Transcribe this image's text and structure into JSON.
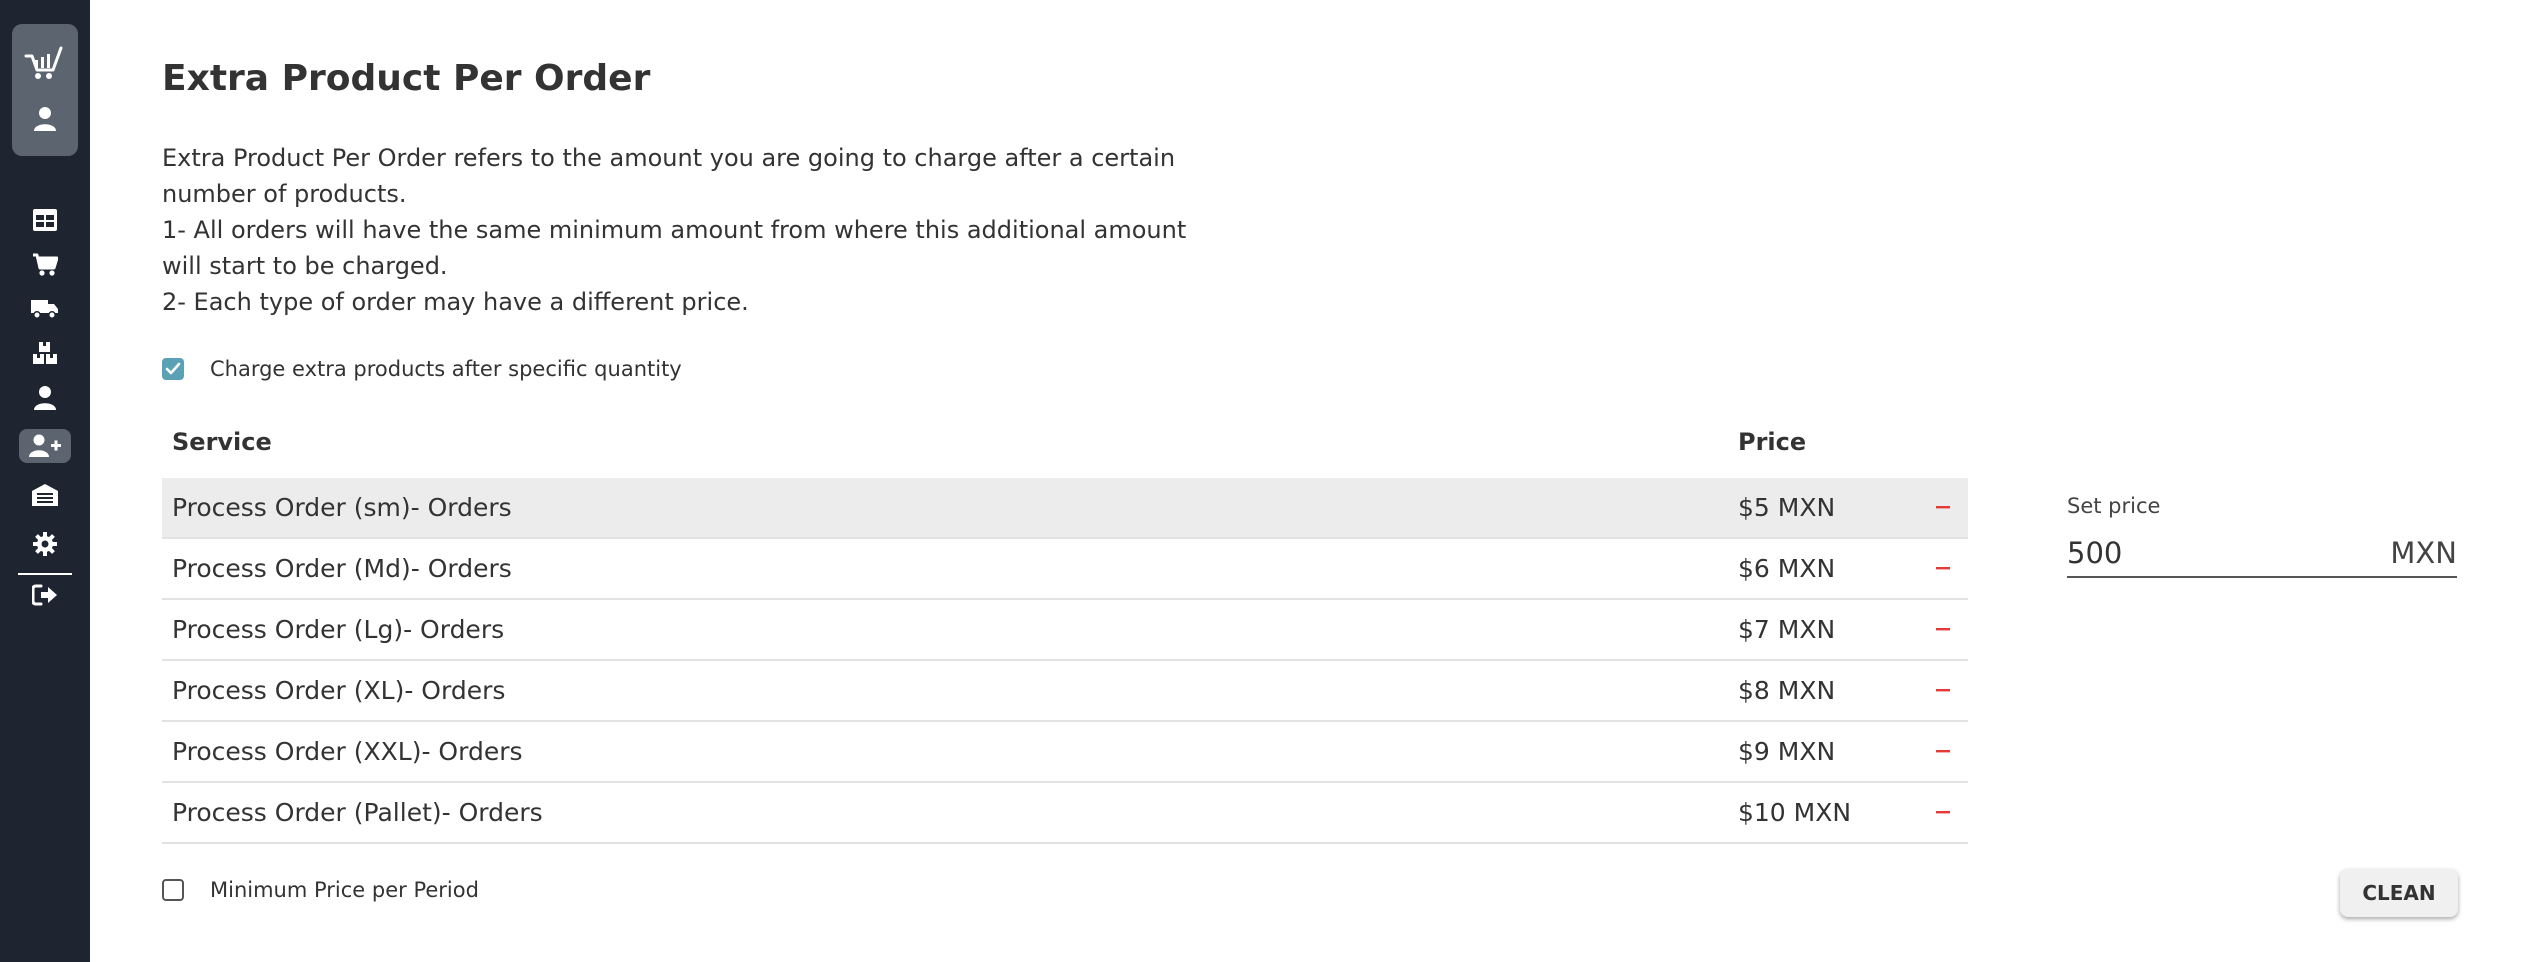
{
  "page": {
    "title": "Extra Product Per Order",
    "description": [
      "Extra Product Per Order refers to the amount you are going to charge after a certain",
      "number of products.",
      "1- All orders will have the same minimum amount from where this additional amount",
      "will start to be charged.",
      "2- Each type of order may have a different price."
    ]
  },
  "colors": {
    "sidebar_bg": "#1f2530",
    "sidebar_active": "#5c6470",
    "checkbox_checked": "#5aa1b6",
    "remove_red": "#e53935",
    "row_highlight": "#ececec"
  },
  "sidebar": {
    "brand_icons": [
      "cart-logo-icon",
      "user-icon"
    ],
    "items": [
      {
        "icon": "table-icon",
        "active": false
      },
      {
        "icon": "cart-icon",
        "active": false
      },
      {
        "icon": "truck-icon",
        "active": false
      },
      {
        "icon": "boxes-icon",
        "active": false
      },
      {
        "icon": "user-icon",
        "active": false
      },
      {
        "icon": "user-plus-icon",
        "active": true
      },
      {
        "icon": "warehouse-icon",
        "active": false
      },
      {
        "icon": "gear-icon",
        "active": false
      },
      {
        "icon": "sign-out-icon",
        "active": false
      }
    ]
  },
  "charge_extra": {
    "label": "Charge extra products after specific quantity",
    "checked": true
  },
  "table": {
    "headers": {
      "service": "Service",
      "price": "Price"
    },
    "rows": [
      {
        "service": "Process Order (sm)- Orders",
        "price": "$5 MXN",
        "highlighted": true
      },
      {
        "service": "Process Order (Md)- Orders",
        "price": "$6 MXN",
        "highlighted": false
      },
      {
        "service": "Process Order (Lg)- Orders",
        "price": "$7 MXN",
        "highlighted": false
      },
      {
        "service": "Process Order (XL)- Orders",
        "price": "$8 MXN",
        "highlighted": false
      },
      {
        "service": "Process Order (XXL)- Orders",
        "price": "$9 MXN",
        "highlighted": false
      },
      {
        "service": "Process Order (Pallet)- Orders",
        "price": "$10 MXN",
        "highlighted": false
      }
    ],
    "remove_icon": "minus-icon"
  },
  "set_price": {
    "label": "Set price",
    "value": "500",
    "unit": "MXN"
  },
  "minimum_price": {
    "label": "Minimum Price per Period",
    "checked": false
  },
  "clean_button": {
    "label": "CLEAN"
  }
}
